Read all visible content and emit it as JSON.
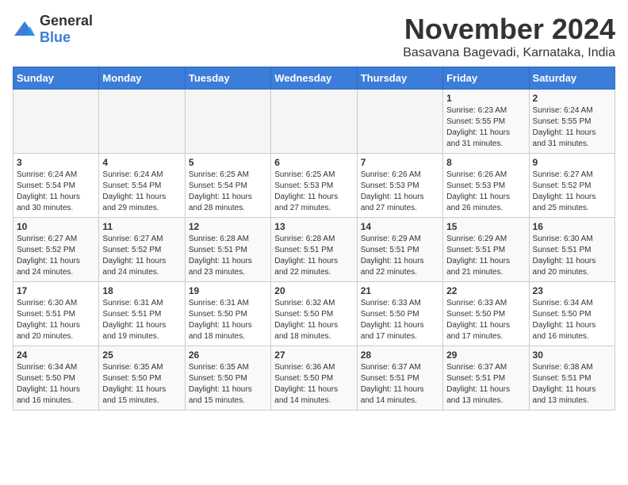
{
  "logo": {
    "text_general": "General",
    "text_blue": "Blue"
  },
  "title": "November 2024",
  "subtitle": "Basavana Bagevadi, Karnataka, India",
  "header_days": [
    "Sunday",
    "Monday",
    "Tuesday",
    "Wednesday",
    "Thursday",
    "Friday",
    "Saturday"
  ],
  "weeks": [
    [
      {
        "day": "",
        "info": ""
      },
      {
        "day": "",
        "info": ""
      },
      {
        "day": "",
        "info": ""
      },
      {
        "day": "",
        "info": ""
      },
      {
        "day": "",
        "info": ""
      },
      {
        "day": "1",
        "info": "Sunrise: 6:23 AM\nSunset: 5:55 PM\nDaylight: 11 hours\nand 31 minutes."
      },
      {
        "day": "2",
        "info": "Sunrise: 6:24 AM\nSunset: 5:55 PM\nDaylight: 11 hours\nand 31 minutes."
      }
    ],
    [
      {
        "day": "3",
        "info": "Sunrise: 6:24 AM\nSunset: 5:54 PM\nDaylight: 11 hours\nand 30 minutes."
      },
      {
        "day": "4",
        "info": "Sunrise: 6:24 AM\nSunset: 5:54 PM\nDaylight: 11 hours\nand 29 minutes."
      },
      {
        "day": "5",
        "info": "Sunrise: 6:25 AM\nSunset: 5:54 PM\nDaylight: 11 hours\nand 28 minutes."
      },
      {
        "day": "6",
        "info": "Sunrise: 6:25 AM\nSunset: 5:53 PM\nDaylight: 11 hours\nand 27 minutes."
      },
      {
        "day": "7",
        "info": "Sunrise: 6:26 AM\nSunset: 5:53 PM\nDaylight: 11 hours\nand 27 minutes."
      },
      {
        "day": "8",
        "info": "Sunrise: 6:26 AM\nSunset: 5:53 PM\nDaylight: 11 hours\nand 26 minutes."
      },
      {
        "day": "9",
        "info": "Sunrise: 6:27 AM\nSunset: 5:52 PM\nDaylight: 11 hours\nand 25 minutes."
      }
    ],
    [
      {
        "day": "10",
        "info": "Sunrise: 6:27 AM\nSunset: 5:52 PM\nDaylight: 11 hours\nand 24 minutes."
      },
      {
        "day": "11",
        "info": "Sunrise: 6:27 AM\nSunset: 5:52 PM\nDaylight: 11 hours\nand 24 minutes."
      },
      {
        "day": "12",
        "info": "Sunrise: 6:28 AM\nSunset: 5:51 PM\nDaylight: 11 hours\nand 23 minutes."
      },
      {
        "day": "13",
        "info": "Sunrise: 6:28 AM\nSunset: 5:51 PM\nDaylight: 11 hours\nand 22 minutes."
      },
      {
        "day": "14",
        "info": "Sunrise: 6:29 AM\nSunset: 5:51 PM\nDaylight: 11 hours\nand 22 minutes."
      },
      {
        "day": "15",
        "info": "Sunrise: 6:29 AM\nSunset: 5:51 PM\nDaylight: 11 hours\nand 21 minutes."
      },
      {
        "day": "16",
        "info": "Sunrise: 6:30 AM\nSunset: 5:51 PM\nDaylight: 11 hours\nand 20 minutes."
      }
    ],
    [
      {
        "day": "17",
        "info": "Sunrise: 6:30 AM\nSunset: 5:51 PM\nDaylight: 11 hours\nand 20 minutes."
      },
      {
        "day": "18",
        "info": "Sunrise: 6:31 AM\nSunset: 5:51 PM\nDaylight: 11 hours\nand 19 minutes."
      },
      {
        "day": "19",
        "info": "Sunrise: 6:31 AM\nSunset: 5:50 PM\nDaylight: 11 hours\nand 18 minutes."
      },
      {
        "day": "20",
        "info": "Sunrise: 6:32 AM\nSunset: 5:50 PM\nDaylight: 11 hours\nand 18 minutes."
      },
      {
        "day": "21",
        "info": "Sunrise: 6:33 AM\nSunset: 5:50 PM\nDaylight: 11 hours\nand 17 minutes."
      },
      {
        "day": "22",
        "info": "Sunrise: 6:33 AM\nSunset: 5:50 PM\nDaylight: 11 hours\nand 17 minutes."
      },
      {
        "day": "23",
        "info": "Sunrise: 6:34 AM\nSunset: 5:50 PM\nDaylight: 11 hours\nand 16 minutes."
      }
    ],
    [
      {
        "day": "24",
        "info": "Sunrise: 6:34 AM\nSunset: 5:50 PM\nDaylight: 11 hours\nand 16 minutes."
      },
      {
        "day": "25",
        "info": "Sunrise: 6:35 AM\nSunset: 5:50 PM\nDaylight: 11 hours\nand 15 minutes."
      },
      {
        "day": "26",
        "info": "Sunrise: 6:35 AM\nSunset: 5:50 PM\nDaylight: 11 hours\nand 15 minutes."
      },
      {
        "day": "27",
        "info": "Sunrise: 6:36 AM\nSunset: 5:50 PM\nDaylight: 11 hours\nand 14 minutes."
      },
      {
        "day": "28",
        "info": "Sunrise: 6:37 AM\nSunset: 5:51 PM\nDaylight: 11 hours\nand 14 minutes."
      },
      {
        "day": "29",
        "info": "Sunrise: 6:37 AM\nSunset: 5:51 PM\nDaylight: 11 hours\nand 13 minutes."
      },
      {
        "day": "30",
        "info": "Sunrise: 6:38 AM\nSunset: 5:51 PM\nDaylight: 11 hours\nand 13 minutes."
      }
    ]
  ]
}
